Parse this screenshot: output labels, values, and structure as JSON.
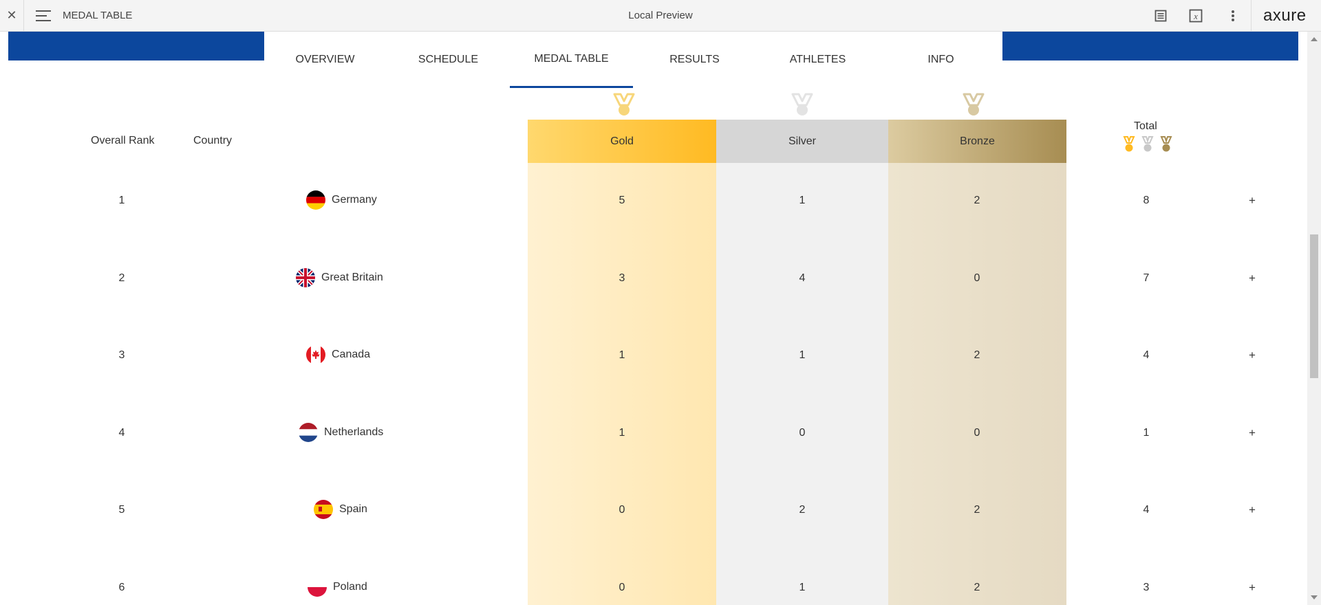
{
  "toolbar": {
    "close_icon": "close-icon",
    "menu_icon": "hamburger-icon",
    "title": "MEDAL TABLE",
    "center_title": "Local Preview",
    "logo": "axure"
  },
  "nav": {
    "tabs": [
      {
        "label": "OVERVIEW",
        "active": false
      },
      {
        "label": "SCHEDULE",
        "active": false
      },
      {
        "label": "MEDAL TABLE",
        "active": true
      },
      {
        "label": "RESULTS",
        "active": false
      },
      {
        "label": "ATHLETES",
        "active": false
      },
      {
        "label": "INFO",
        "active": false
      }
    ]
  },
  "table": {
    "headers": {
      "rank": "Overall Rank",
      "country": "Country",
      "gold": "Gold",
      "silver": "Silver",
      "bronze": "Bronze",
      "total": "Total"
    },
    "expand_label": "+",
    "rows": [
      {
        "rank": "1",
        "country": "Germany",
        "gold": "5",
        "silver": "1",
        "bronze": "2",
        "total": "8"
      },
      {
        "rank": "2",
        "country": "Great Britain",
        "gold": "3",
        "silver": "4",
        "bronze": "0",
        "total": "7"
      },
      {
        "rank": "3",
        "country": "Canada",
        "gold": "1",
        "silver": "1",
        "bronze": "2",
        "total": "4"
      },
      {
        "rank": "4",
        "country": "Netherlands",
        "gold": "1",
        "silver": "0",
        "bronze": "0",
        "total": "1"
      },
      {
        "rank": "5",
        "country": "Spain",
        "gold": "0",
        "silver": "2",
        "bronze": "2",
        "total": "4"
      },
      {
        "rank": "6",
        "country": "Poland",
        "gold": "0",
        "silver": "1",
        "bronze": "2",
        "total": "3"
      }
    ]
  },
  "colors": {
    "brand_blue": "#0c479d",
    "gold": "#ffba22",
    "silver": "#d6d6d6",
    "bronze": "#a78d52"
  }
}
